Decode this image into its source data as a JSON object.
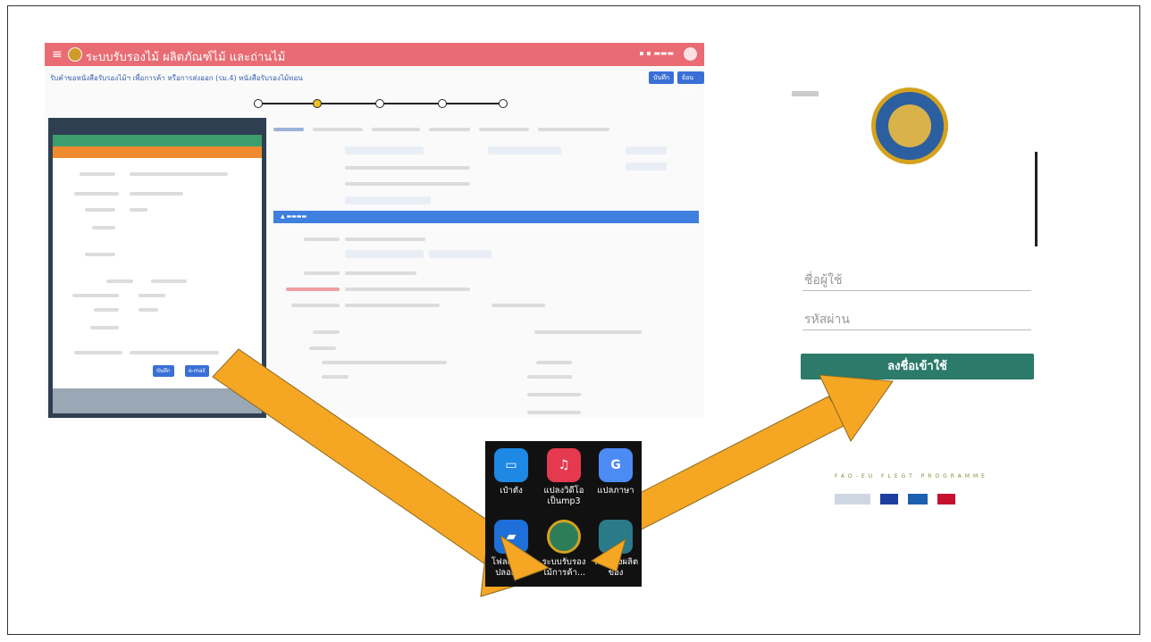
{
  "webapp": {
    "menu_glyph": "≡",
    "title": "ระบบรับรองไม้ ผลิตภัณฑ์ไม้ และถ่านไม้",
    "breadcrumb": "รับคำขอหนังสือรับรองไม้ฯ เพื่อการค้า หรือการส่งออก (รม.4) หนังสือรับรองไม้ทอน",
    "save_btn": "บันทึก",
    "back_btn": "ย้อนกลับ",
    "panel_save_btn": "บันทึก",
    "panel_email_btn": "e-mail"
  },
  "login": {
    "username_placeholder": "ชื่อผู้ใช้",
    "password_placeholder": "รหัสผ่าน",
    "login_button": "ลงชื่อเข้าใช้",
    "partners_heading": "FAO-EU FLEGT PROGRAMME"
  },
  "apps": [
    {
      "label_1": "เป๋าตัง",
      "label_2": "",
      "color": "#1e88e5",
      "icon": "wallet-icon"
    },
    {
      "label_1": "แปลงวิดีโอ",
      "label_2": "เป็นmp3",
      "color": "#e53950",
      "icon": "music-icon"
    },
    {
      "label_1": "แปลภาษา",
      "label_2": "",
      "color": "#4c8bf5",
      "icon": "translate-icon"
    },
    {
      "label_1": "โฟลเดอร์ที่",
      "label_2": "ปลอดภัย",
      "color": "#1e6fd9",
      "icon": "folder-icon"
    },
    {
      "label_1": "ระบบรับรอง",
      "label_2": "ไม้การค้า...",
      "color": "#2e7d59",
      "icon": "emblem-icon"
    },
    {
      "label_1": "ระบบส่งผลิต",
      "label_2": "ของ",
      "color": "#2b7a8a",
      "icon": "app-icon"
    }
  ],
  "colors": {
    "topbar": "#e96b73",
    "arrow": "#f5a623",
    "login_button": "#2b7a6a"
  }
}
